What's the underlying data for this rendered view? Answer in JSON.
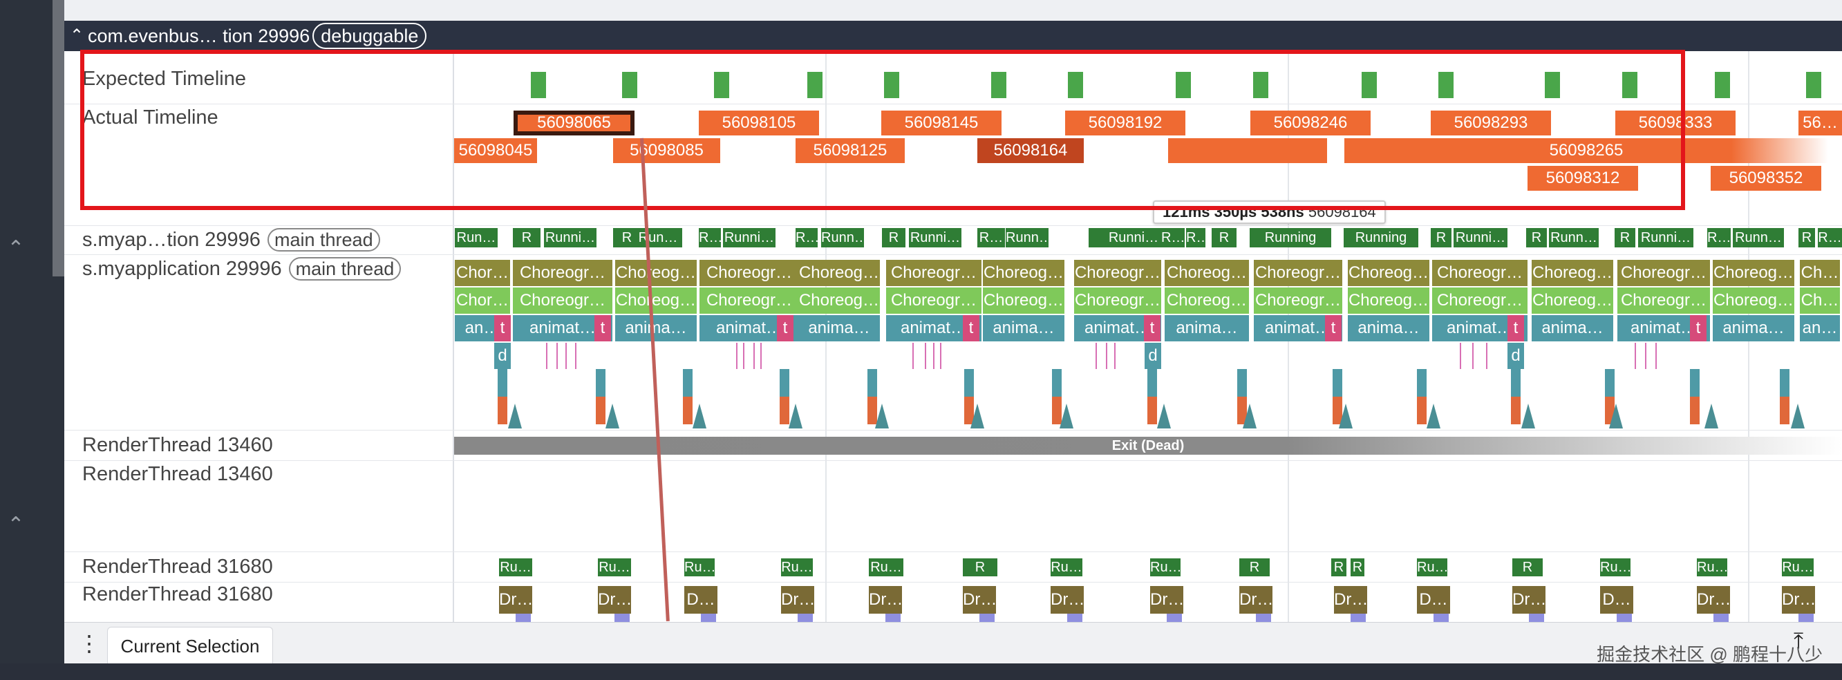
{
  "process": {
    "title": "com.evenbus… tion 29996",
    "badge": "debuggable"
  },
  "tracks": {
    "expected": "Expected Timeline",
    "actual": "Actual Timeline",
    "state_thread": "s.myap…tion 29996",
    "state_badge": "main thread",
    "main_thread": "s.myapplication 29996",
    "main_badge": "main thread",
    "render1a": "RenderThread 13460",
    "render1b": "RenderThread 13460",
    "render2a": "RenderThread 31680",
    "render2b": "RenderThread 31680"
  },
  "frames_row1": [
    "56098065",
    "56098105",
    "56098145",
    "56098192",
    "56098246",
    "56098293",
    "56098333",
    "56…"
  ],
  "frames_row2": [
    "56098045",
    "56098085",
    "56098125",
    "56098164",
    "56098265"
  ],
  "frames_row3": [
    "56098312",
    "56098352"
  ],
  "tooltip": {
    "time": "121ms 350µs 538ns",
    "id": "56098164"
  },
  "exit_label": "Exit (Dead)",
  "bottom": {
    "tab": "Current Selection",
    "watermark": "掘金技术社区 @ 鹏程十八少"
  },
  "state_labels": [
    "Run…",
    "R",
    "Runni…",
    "R",
    "Run…",
    "R…",
    "Runni…",
    "R…",
    "Runn…",
    "R",
    "Runni…",
    "R…",
    "Runn…",
    "Runni…",
    "R…",
    "R…",
    "R",
    "Running",
    "Running",
    "R",
    "Runni…",
    "R",
    "Runn…",
    "R",
    "Runni…",
    "R…",
    "Runn…",
    "R",
    "R…"
  ],
  "chor_dark": [
    "Chor…",
    "Choreogr…",
    "Choreog…",
    "Choreogr…",
    "Choreog…",
    "Choreogr…",
    "Choreog…",
    "Choreogr…",
    "Choreog…",
    "Choreogr…",
    "Choreog…",
    "Choreogr…",
    "Choreog…",
    "Choreogr…",
    "Choreog…",
    "Ch…"
  ],
  "chor_light": [
    "Chor…",
    "Choreogr…",
    "Choreog…",
    "Choreogr…",
    "Choreog…",
    "Choreogr…",
    "Choreog…",
    "Choreogr…",
    "Choreog…",
    "Choreogr…",
    "Choreog…",
    "Choreogr…",
    "Choreog…",
    "Choreogr…",
    "Choreog…",
    "Ch…"
  ],
  "anim": [
    "an…",
    "animat…",
    "anima…",
    "animat…",
    "anima…",
    "animat…",
    "anima…",
    "animat…",
    "anima…",
    "animat…",
    "anima…",
    "animat…",
    "anima…",
    "animat…",
    "anima…",
    "an…"
  ],
  "pink_label": "t",
  "d_label": "d",
  "rt_labels": [
    "Ru…",
    "Ru…",
    "Ru…",
    "Ru…",
    "Ru…",
    "R",
    "Ru…",
    "Ru…",
    "R",
    "R",
    "R",
    "Ru…",
    "R",
    "Ru…",
    "Ru…",
    "Ru…"
  ],
  "draw_labels": [
    "Dr…",
    "Dr…",
    "D…",
    "Dr…",
    "Dr…",
    "Dr…",
    "Dr…",
    "Dr…",
    "Dr…",
    "Dr…",
    "D…",
    "Dr…",
    "D…",
    "Dr…",
    "Dr…"
  ],
  "colors": {
    "frame": "#ef6a32",
    "selected_frame_border": "#3a1a10",
    "highlight_box": "#e3161b",
    "expected": "#4aa64a"
  }
}
